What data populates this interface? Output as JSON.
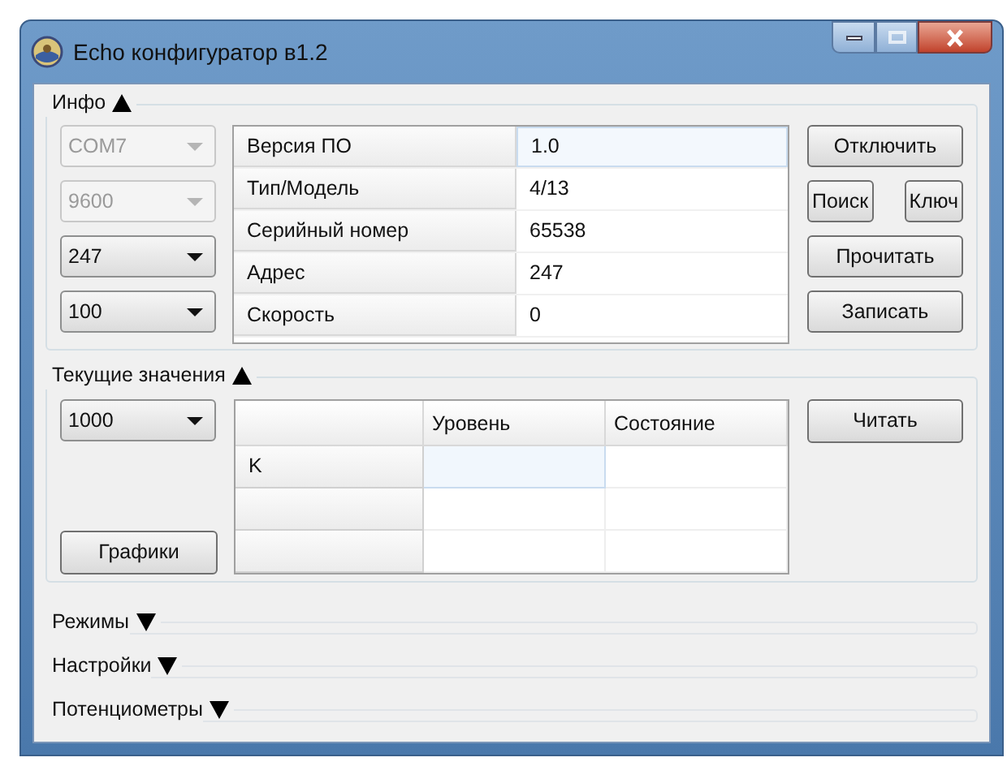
{
  "window": {
    "title": "Echo конфигуратор в1.2"
  },
  "info": {
    "title": "Инфо",
    "expanded": true,
    "combos": [
      {
        "value": "COM7",
        "disabled": true
      },
      {
        "value": "9600",
        "disabled": true
      },
      {
        "value": "247",
        "disabled": false
      },
      {
        "value": "100",
        "disabled": false
      }
    ],
    "rows": [
      {
        "label": "Версия ПО",
        "value": "1.0",
        "selected": true
      },
      {
        "label": "Тип/Модель",
        "value": "4/13",
        "selected": false
      },
      {
        "label": "Серийный номер",
        "value": "65538",
        "selected": false
      },
      {
        "label": "Адрес",
        "value": "247",
        "selected": false
      },
      {
        "label": "Скорость",
        "value": "0",
        "selected": false
      }
    ],
    "buttons": [
      [
        "Отключить"
      ],
      [
        "Поиск",
        "Ключ"
      ],
      [
        "Прочитать"
      ],
      [
        "Записать"
      ]
    ]
  },
  "current": {
    "title": "Текущие значения",
    "expanded": true,
    "combo": {
      "value": "1000",
      "disabled": false
    },
    "columns": [
      "Уровень",
      "Состояние"
    ],
    "rows": [
      {
        "header": "K",
        "cells": [
          {
            "selected": true
          },
          {
            "selected": false
          }
        ]
      },
      {
        "cells": [
          {
            "selected": false
          },
          {
            "selected": false
          }
        ]
      },
      {
        "cells": [
          {
            "selected": false
          },
          {
            "selected": false
          }
        ]
      }
    ],
    "graphs_button": "Графики",
    "read_button": "Читать"
  },
  "sections": [
    {
      "title": "Режимы",
      "expanded": false
    },
    {
      "title": "Настройки",
      "expanded": false
    },
    {
      "title": "Потенциометры",
      "expanded": false
    }
  ]
}
